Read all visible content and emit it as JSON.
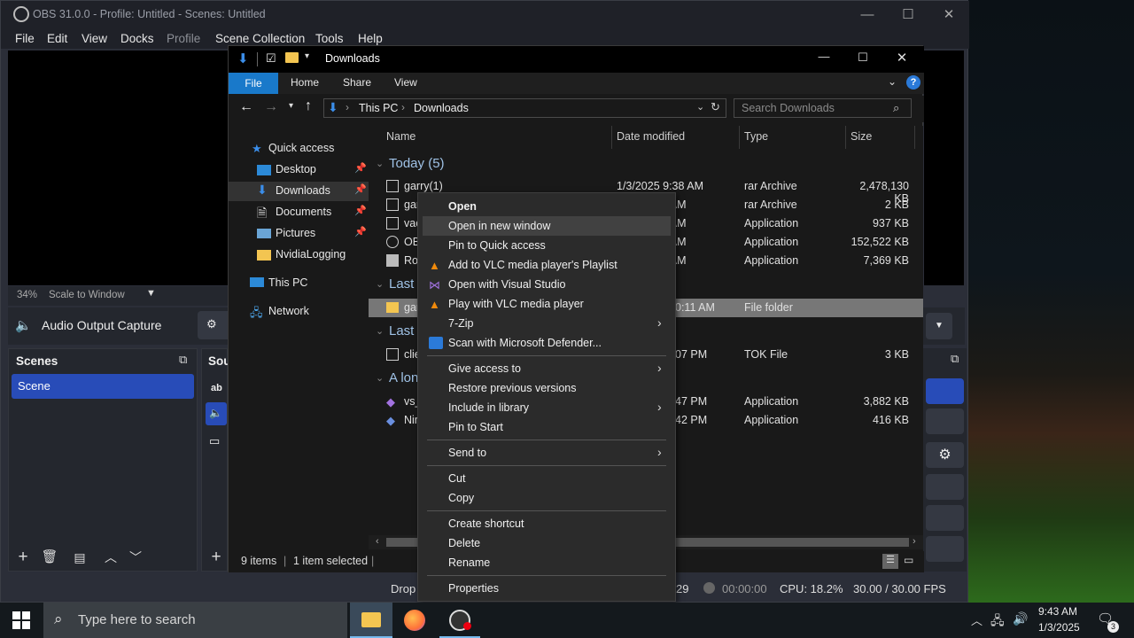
{
  "obs": {
    "title": "OBS 31.0.0 - Profile: Untitled - Scenes: Untitled",
    "menu": [
      "File",
      "Edit",
      "View",
      "Docks",
      "Profile",
      "Scene Collection",
      "Tools",
      "Help"
    ],
    "zoom": "34%",
    "scale_mode": "Scale to Window",
    "source_bar_label": "Audio Output Capture",
    "docks": {
      "scenes_title": "Scenes",
      "sources_title": "Sou"
    },
    "scene_item": "Scene",
    "sources_partial": [
      "ab"
    ],
    "status": {
      "drop": "Drop",
      "frames": "29",
      "rec_time": "00:00:00",
      "cpu": "CPU: 18.2%",
      "fps": "30.00 / 30.00 FPS"
    }
  },
  "explorer": {
    "title": "Downloads",
    "ribbon_tabs": [
      "File",
      "Home",
      "Share",
      "View"
    ],
    "breadcrumb": [
      "This PC",
      "Downloads"
    ],
    "search_placeholder": "Search Downloads",
    "nav": [
      {
        "label": "Quick access",
        "pinned": false
      },
      {
        "label": "Desktop",
        "pinned": true
      },
      {
        "label": "Downloads",
        "pinned": true
      },
      {
        "label": "Documents",
        "pinned": true
      },
      {
        "label": "Pictures",
        "pinned": true
      },
      {
        "label": "NvidiaLogging",
        "pinned": false
      },
      {
        "label": "This PC",
        "pinned": false
      },
      {
        "label": "Network",
        "pinned": false
      }
    ],
    "columns": [
      "Name",
      "Date modified",
      "Type",
      "Size"
    ],
    "groups": [
      "Today (5)",
      "Last w",
      "Last m",
      "A lon"
    ],
    "rows": [
      {
        "name": "garry(1)",
        "date": "1/3/2025 9:38 AM",
        "type": "rar Archive",
        "size": "2,478,130 KB"
      },
      {
        "name": "gar",
        "date": "2 AM",
        "type": "rar Archive",
        "size": "2 KB"
      },
      {
        "name": "vac",
        "date": "2 AM",
        "type": "Application",
        "size": "937 KB"
      },
      {
        "name": "OB",
        "date": "9 AM",
        "type": "Application",
        "size": "152,522 KB"
      },
      {
        "name": "Ro",
        "date": "3 AM",
        "type": "Application",
        "size": "7,369 KB"
      },
      {
        "name": "gar",
        "date": "0:11 AM",
        "type": "File folder",
        "size": ""
      },
      {
        "name": "clie",
        "date": "07 PM",
        "type": "TOK File",
        "size": "3 KB"
      },
      {
        "name": "vs_",
        "date": "47 PM",
        "type": "Application",
        "size": "3,882 KB"
      },
      {
        "name": "Nir",
        "date": "42 PM",
        "type": "Application",
        "size": "416 KB"
      }
    ],
    "status": {
      "count": "9 items",
      "selected": "1 item selected"
    }
  },
  "context_menu": {
    "items": [
      {
        "label": "Open"
      },
      {
        "label": "Open in new window"
      },
      {
        "label": "Pin to Quick access"
      },
      {
        "label": "Add to VLC media player's Playlist"
      },
      {
        "label": "Open with Visual Studio"
      },
      {
        "label": "Play with VLC media player"
      },
      {
        "label": "7-Zip"
      },
      {
        "label": "Scan with Microsoft Defender..."
      },
      {
        "label": "Give access to"
      },
      {
        "label": "Restore previous versions"
      },
      {
        "label": "Include in library"
      },
      {
        "label": "Pin to Start"
      },
      {
        "label": "Send to"
      },
      {
        "label": "Cut"
      },
      {
        "label": "Copy"
      },
      {
        "label": "Create shortcut"
      },
      {
        "label": "Delete"
      },
      {
        "label": "Rename"
      },
      {
        "label": "Properties"
      }
    ]
  },
  "taskbar": {
    "search_placeholder": "Type here to search",
    "time": "9:43 AM",
    "date": "1/3/2025",
    "notification_count": "3"
  },
  "colors": {
    "accent": "#1979ca",
    "obs_scene_selected": "#284cb8",
    "explorer_bg": "#191919"
  }
}
